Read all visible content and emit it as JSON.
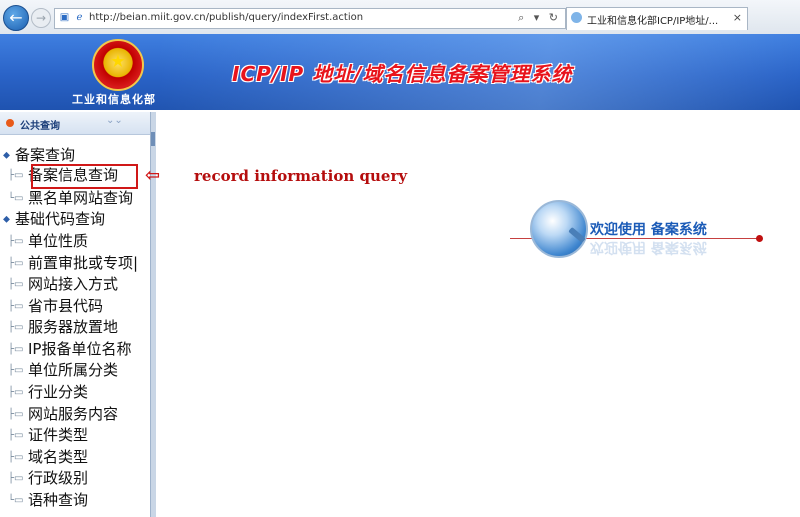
{
  "browser": {
    "url": "http://beian.miit.gov.cn/publish/query/indexFirst.action",
    "tab_title": "工业和信息化部ICP/IP地址/...",
    "tab_close": "×",
    "addr_tools": "⌕ ▾ ↻"
  },
  "header": {
    "ministry": "工业和信息化部",
    "system_title": "ICP/IP 地址/域名信息备案管理系统"
  },
  "sidebar": {
    "panel_label": "公共查询",
    "groups": [
      {
        "label": "备案查询",
        "items": [
          {
            "label": "备案信息查询"
          },
          {
            "label": "黑名单网站查询"
          }
        ]
      },
      {
        "label": "基础代码查询",
        "items": [
          {
            "label": "单位性质"
          },
          {
            "label": "前置审批或专项|"
          },
          {
            "label": "网站接入方式"
          },
          {
            "label": "省市县代码"
          },
          {
            "label": "服务器放置地"
          },
          {
            "label": "IP报备单位名称"
          },
          {
            "label": "单位所属分类"
          },
          {
            "label": "行业分类"
          },
          {
            "label": "网站服务内容"
          },
          {
            "label": "证件类型"
          },
          {
            "label": "域名类型"
          },
          {
            "label": "行政级别"
          },
          {
            "label": "语种查询"
          }
        ]
      }
    ]
  },
  "annotation": {
    "arrow": "⇦",
    "text": "record information query"
  },
  "welcome": {
    "text": "欢迎使用  备案系统"
  },
  "colors": {
    "header_blue": "#2a63c7",
    "title_red": "#e8141c",
    "highlight_red": "#d01818",
    "welcome_blue": "#1b5bb7"
  },
  "icons": {
    "back": "back-arrow-icon",
    "forward": "forward-arrow-icon",
    "tree_group": "folder-icon",
    "tree_item": "document-icon"
  }
}
